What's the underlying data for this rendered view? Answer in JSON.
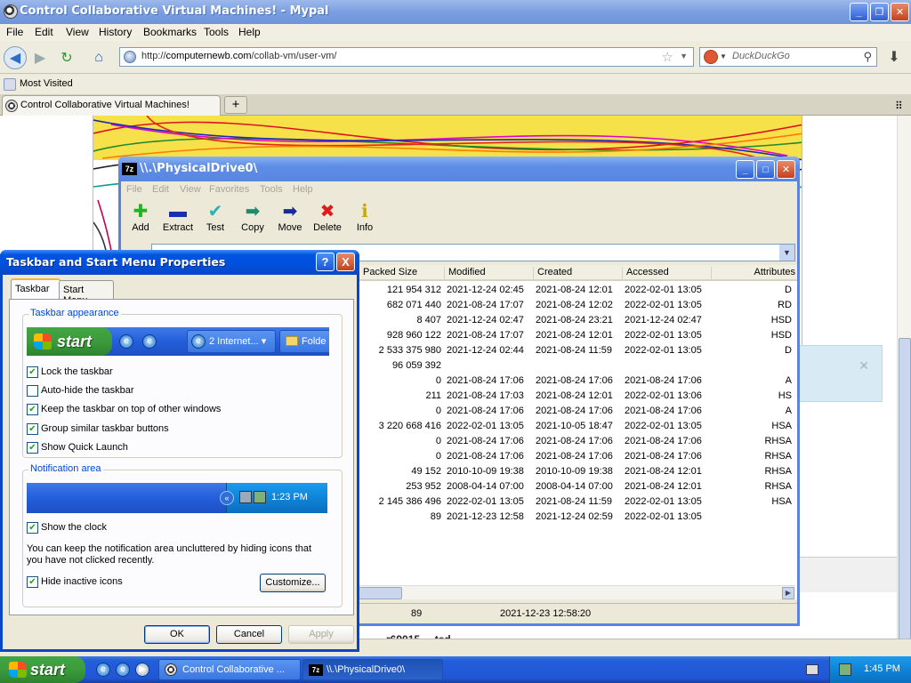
{
  "browser": {
    "title": "Control Collaborative Virtual Machines! - Mypal",
    "menu": [
      "File",
      "Edit",
      "View",
      "History",
      "Bookmarks",
      "Tools",
      "Help"
    ],
    "url_prefix": "http://",
    "url_host": "computernewb.com",
    "url_path": "/collab-vm/user-vm/",
    "search_placeholder": "DuckDuckGo",
    "bookmark": "Most Visited",
    "tab_title": "Control Collaborative Virtual Machines!",
    "new_tab": "+",
    "page_text": "r69015 ... ted"
  },
  "sevenzip": {
    "title": "\\\\.\\PhysicalDrive0\\",
    "logo": "7z",
    "menu": [
      "File",
      "Edit",
      "View",
      "Favorites",
      "Tools",
      "Help"
    ],
    "toolbar": [
      {
        "label": "Add",
        "icon": "plus-icon",
        "color": "#22b422"
      },
      {
        "label": "Extract",
        "icon": "minus-icon",
        "color": "#1a2fb0"
      },
      {
        "label": "Test",
        "icon": "check-icon",
        "color": "#2ab3b0"
      },
      {
        "label": "Copy",
        "icon": "arrow-right-icon",
        "color": "#1e8a6e"
      },
      {
        "label": "Move",
        "icon": "arrow-right-icon",
        "color": "#1a2a9a"
      },
      {
        "label": "Delete",
        "icon": "x-icon",
        "color": "#e01a1a"
      },
      {
        "label": "Info",
        "icon": "info-icon",
        "color": "#c8a800"
      }
    ],
    "columns": [
      "Packed Size",
      "Modified",
      "Created",
      "Accessed",
      "Attributes"
    ],
    "rows": [
      [
        "121 954 312",
        "2021-12-24 02:45",
        "2021-08-24 12:01",
        "2022-02-01 13:05",
        "D"
      ],
      [
        "682 071 440",
        "2021-08-24 17:07",
        "2021-08-24 12:02",
        "2022-02-01 13:05",
        "RD"
      ],
      [
        "8 407",
        "2021-12-24 02:47",
        "2021-08-24 23:21",
        "2021-12-24 02:47",
        "HSD"
      ],
      [
        "928 960 122",
        "2021-08-24 17:07",
        "2021-08-24 12:01",
        "2022-02-01 13:05",
        "HSD"
      ],
      [
        "2 533 375 980",
        "2021-12-24 02:44",
        "2021-08-24 11:59",
        "2022-02-01 13:05",
        "D"
      ],
      [
        "96 059 392",
        "",
        "",
        "",
        ""
      ],
      [
        "0",
        "2021-08-24 17:06",
        "2021-08-24 17:06",
        "2021-08-24 17:06",
        "A"
      ],
      [
        "211",
        "2021-08-24 17:03",
        "2021-08-24 12:01",
        "2022-02-01 13:06",
        "HS"
      ],
      [
        "0",
        "2021-08-24 17:06",
        "2021-08-24 17:06",
        "2021-08-24 17:06",
        "A"
      ],
      [
        "3 220 668 416",
        "2022-02-01 13:05",
        "2021-10-05 18:47",
        "2022-02-01 13:05",
        "HSA"
      ],
      [
        "0",
        "2021-08-24 17:06",
        "2021-08-24 17:06",
        "2021-08-24 17:06",
        "RHSA"
      ],
      [
        "0",
        "2021-08-24 17:06",
        "2021-08-24 17:06",
        "2021-08-24 17:06",
        "RHSA"
      ],
      [
        "49 152",
        "2010-10-09 19:38",
        "2010-10-09 19:38",
        "2021-08-24 12:01",
        "RHSA"
      ],
      [
        "253 952",
        "2008-04-14 07:00",
        "2008-04-14 07:00",
        "2021-08-24 12:01",
        "RHSA"
      ],
      [
        "2 145 386 496",
        "2022-02-01 13:05",
        "2021-08-24 11:59",
        "2022-02-01 13:05",
        "HSA"
      ],
      [
        "89",
        "2021-12-23 12:58",
        "2021-12-24 02:59",
        "2022-02-01 13:05",
        ""
      ]
    ],
    "status_size": "89",
    "status_date": "2021-12-23 12:58:20"
  },
  "dialog": {
    "title": "Taskbar and Start Menu Properties",
    "help": "?",
    "close": "X",
    "tabs": [
      "Taskbar",
      "Start Menu"
    ],
    "appearance_label": "Taskbar appearance",
    "preview_start": "start",
    "preview_task1": "2 Internet...",
    "preview_task2": "Folde",
    "options": [
      {
        "label": "Lock the taskbar",
        "checked": true
      },
      {
        "label": "Auto-hide the taskbar",
        "checked": false
      },
      {
        "label": "Keep the taskbar on top of other windows",
        "checked": true
      },
      {
        "label": "Group similar taskbar buttons",
        "checked": true
      },
      {
        "label": "Show Quick Launch",
        "checked": true
      }
    ],
    "notification_label": "Notification area",
    "tray_time": "1:23 PM",
    "show_clock": "Show the clock",
    "info_text": "You can keep the notification area uncluttered by hiding icons that you have not clicked recently.",
    "hide_inactive": "Hide inactive icons",
    "customize": "Customize...",
    "ok": "OK",
    "cancel": "Cancel",
    "apply": "Apply"
  },
  "taskbar": {
    "start": "start",
    "tasks": [
      "Control Collaborative ...",
      "\\\\.\\PhysicalDrive0\\"
    ],
    "time": "1:45 PM"
  },
  "colors": {
    "xp_blue": "#245edb",
    "xp_green": "#3c9b3c",
    "dialog_title": "#0050dc",
    "group_label": "#0046d5"
  }
}
